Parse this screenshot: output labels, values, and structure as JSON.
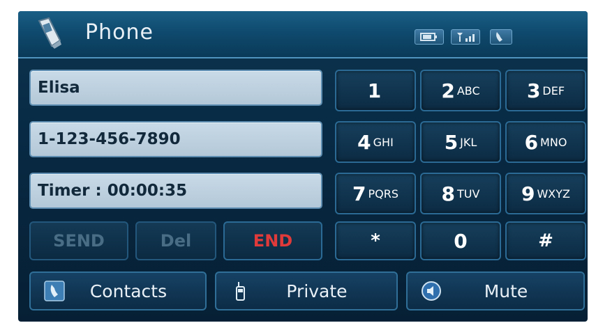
{
  "header": {
    "title": "Phone",
    "status_icons": [
      "battery-icon",
      "signal-strength-icon",
      "call-active-icon"
    ]
  },
  "call_info": {
    "name": "Elisa",
    "number": "1-123-456-7890",
    "timer": "Timer : 00:00:35"
  },
  "keypad": [
    {
      "digit": "1",
      "letters": ""
    },
    {
      "digit": "2",
      "letters": "ABC"
    },
    {
      "digit": "3",
      "letters": "DEF"
    },
    {
      "digit": "4",
      "letters": "GHI"
    },
    {
      "digit": "5",
      "letters": "JKL"
    },
    {
      "digit": "6",
      "letters": "MNO"
    },
    {
      "digit": "7",
      "letters": "PQRS"
    },
    {
      "digit": "8",
      "letters": "TUV"
    },
    {
      "digit": "9",
      "letters": "WXYZ"
    },
    {
      "digit": "*",
      "letters": ""
    },
    {
      "digit": "0",
      "letters": ""
    },
    {
      "digit": "#",
      "letters": ""
    }
  ],
  "controls": {
    "send": "SEND",
    "del": "Del",
    "end": "END"
  },
  "bottom_bar": {
    "contacts": "Contacts",
    "private": "Private",
    "mute": "Mute"
  },
  "colors": {
    "background": "#082a44",
    "header": "#0f4a6e",
    "info_field": "#c2d4e2",
    "end_text": "#e03a3a",
    "disabled_text": "#4a6d86"
  }
}
